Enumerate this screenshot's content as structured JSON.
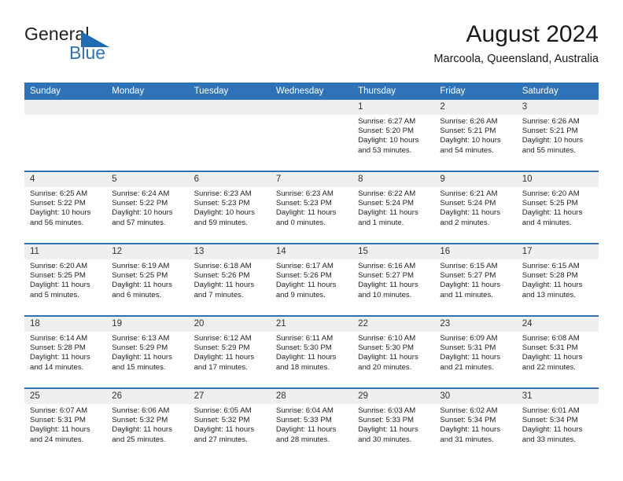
{
  "brand": {
    "name_part1": "General",
    "name_part2": "Blue",
    "accent_color": "#2e72b8"
  },
  "header": {
    "title": "August 2024",
    "subtitle": "Marcoola, Queensland, Australia"
  },
  "weekday_headers": [
    "Sunday",
    "Monday",
    "Tuesday",
    "Wednesday",
    "Thursday",
    "Friday",
    "Saturday"
  ],
  "labels": {
    "sunrise_prefix": "Sunrise:",
    "sunset_prefix": "Sunset:",
    "daylight_prefix": "Daylight:"
  },
  "colors": {
    "header_blue": "#2e72b8",
    "daynum_band": "#efefef",
    "row_separator": "#2e72b8",
    "text": "#222222"
  },
  "weeks": [
    [
      {
        "day": "",
        "empty": true
      },
      {
        "day": "",
        "empty": true
      },
      {
        "day": "",
        "empty": true
      },
      {
        "day": "",
        "empty": true
      },
      {
        "day": "1",
        "sunrise": "Sunrise: 6:27 AM",
        "sunset": "Sunset: 5:20 PM",
        "daylight": "Daylight: 10 hours and 53 minutes."
      },
      {
        "day": "2",
        "sunrise": "Sunrise: 6:26 AM",
        "sunset": "Sunset: 5:21 PM",
        "daylight": "Daylight: 10 hours and 54 minutes."
      },
      {
        "day": "3",
        "sunrise": "Sunrise: 6:26 AM",
        "sunset": "Sunset: 5:21 PM",
        "daylight": "Daylight: 10 hours and 55 minutes."
      }
    ],
    [
      {
        "day": "4",
        "sunrise": "Sunrise: 6:25 AM",
        "sunset": "Sunset: 5:22 PM",
        "daylight": "Daylight: 10 hours and 56 minutes."
      },
      {
        "day": "5",
        "sunrise": "Sunrise: 6:24 AM",
        "sunset": "Sunset: 5:22 PM",
        "daylight": "Daylight: 10 hours and 57 minutes."
      },
      {
        "day": "6",
        "sunrise": "Sunrise: 6:23 AM",
        "sunset": "Sunset: 5:23 PM",
        "daylight": "Daylight: 10 hours and 59 minutes."
      },
      {
        "day": "7",
        "sunrise": "Sunrise: 6:23 AM",
        "sunset": "Sunset: 5:23 PM",
        "daylight": "Daylight: 11 hours and 0 minutes."
      },
      {
        "day": "8",
        "sunrise": "Sunrise: 6:22 AM",
        "sunset": "Sunset: 5:24 PM",
        "daylight": "Daylight: 11 hours and 1 minute."
      },
      {
        "day": "9",
        "sunrise": "Sunrise: 6:21 AM",
        "sunset": "Sunset: 5:24 PM",
        "daylight": "Daylight: 11 hours and 2 minutes."
      },
      {
        "day": "10",
        "sunrise": "Sunrise: 6:20 AM",
        "sunset": "Sunset: 5:25 PM",
        "daylight": "Daylight: 11 hours and 4 minutes."
      }
    ],
    [
      {
        "day": "11",
        "sunrise": "Sunrise: 6:20 AM",
        "sunset": "Sunset: 5:25 PM",
        "daylight": "Daylight: 11 hours and 5 minutes."
      },
      {
        "day": "12",
        "sunrise": "Sunrise: 6:19 AM",
        "sunset": "Sunset: 5:25 PM",
        "daylight": "Daylight: 11 hours and 6 minutes."
      },
      {
        "day": "13",
        "sunrise": "Sunrise: 6:18 AM",
        "sunset": "Sunset: 5:26 PM",
        "daylight": "Daylight: 11 hours and 7 minutes."
      },
      {
        "day": "14",
        "sunrise": "Sunrise: 6:17 AM",
        "sunset": "Sunset: 5:26 PM",
        "daylight": "Daylight: 11 hours and 9 minutes."
      },
      {
        "day": "15",
        "sunrise": "Sunrise: 6:16 AM",
        "sunset": "Sunset: 5:27 PM",
        "daylight": "Daylight: 11 hours and 10 minutes."
      },
      {
        "day": "16",
        "sunrise": "Sunrise: 6:15 AM",
        "sunset": "Sunset: 5:27 PM",
        "daylight": "Daylight: 11 hours and 11 minutes."
      },
      {
        "day": "17",
        "sunrise": "Sunrise: 6:15 AM",
        "sunset": "Sunset: 5:28 PM",
        "daylight": "Daylight: 11 hours and 13 minutes."
      }
    ],
    [
      {
        "day": "18",
        "sunrise": "Sunrise: 6:14 AM",
        "sunset": "Sunset: 5:28 PM",
        "daylight": "Daylight: 11 hours and 14 minutes."
      },
      {
        "day": "19",
        "sunrise": "Sunrise: 6:13 AM",
        "sunset": "Sunset: 5:29 PM",
        "daylight": "Daylight: 11 hours and 15 minutes."
      },
      {
        "day": "20",
        "sunrise": "Sunrise: 6:12 AM",
        "sunset": "Sunset: 5:29 PM",
        "daylight": "Daylight: 11 hours and 17 minutes."
      },
      {
        "day": "21",
        "sunrise": "Sunrise: 6:11 AM",
        "sunset": "Sunset: 5:30 PM",
        "daylight": "Daylight: 11 hours and 18 minutes."
      },
      {
        "day": "22",
        "sunrise": "Sunrise: 6:10 AM",
        "sunset": "Sunset: 5:30 PM",
        "daylight": "Daylight: 11 hours and 20 minutes."
      },
      {
        "day": "23",
        "sunrise": "Sunrise: 6:09 AM",
        "sunset": "Sunset: 5:31 PM",
        "daylight": "Daylight: 11 hours and 21 minutes."
      },
      {
        "day": "24",
        "sunrise": "Sunrise: 6:08 AM",
        "sunset": "Sunset: 5:31 PM",
        "daylight": "Daylight: 11 hours and 22 minutes."
      }
    ],
    [
      {
        "day": "25",
        "sunrise": "Sunrise: 6:07 AM",
        "sunset": "Sunset: 5:31 PM",
        "daylight": "Daylight: 11 hours and 24 minutes."
      },
      {
        "day": "26",
        "sunrise": "Sunrise: 6:06 AM",
        "sunset": "Sunset: 5:32 PM",
        "daylight": "Daylight: 11 hours and 25 minutes."
      },
      {
        "day": "27",
        "sunrise": "Sunrise: 6:05 AM",
        "sunset": "Sunset: 5:32 PM",
        "daylight": "Daylight: 11 hours and 27 minutes."
      },
      {
        "day": "28",
        "sunrise": "Sunrise: 6:04 AM",
        "sunset": "Sunset: 5:33 PM",
        "daylight": "Daylight: 11 hours and 28 minutes."
      },
      {
        "day": "29",
        "sunrise": "Sunrise: 6:03 AM",
        "sunset": "Sunset: 5:33 PM",
        "daylight": "Daylight: 11 hours and 30 minutes."
      },
      {
        "day": "30",
        "sunrise": "Sunrise: 6:02 AM",
        "sunset": "Sunset: 5:34 PM",
        "daylight": "Daylight: 11 hours and 31 minutes."
      },
      {
        "day": "31",
        "sunrise": "Sunrise: 6:01 AM",
        "sunset": "Sunset: 5:34 PM",
        "daylight": "Daylight: 11 hours and 33 minutes."
      }
    ]
  ]
}
